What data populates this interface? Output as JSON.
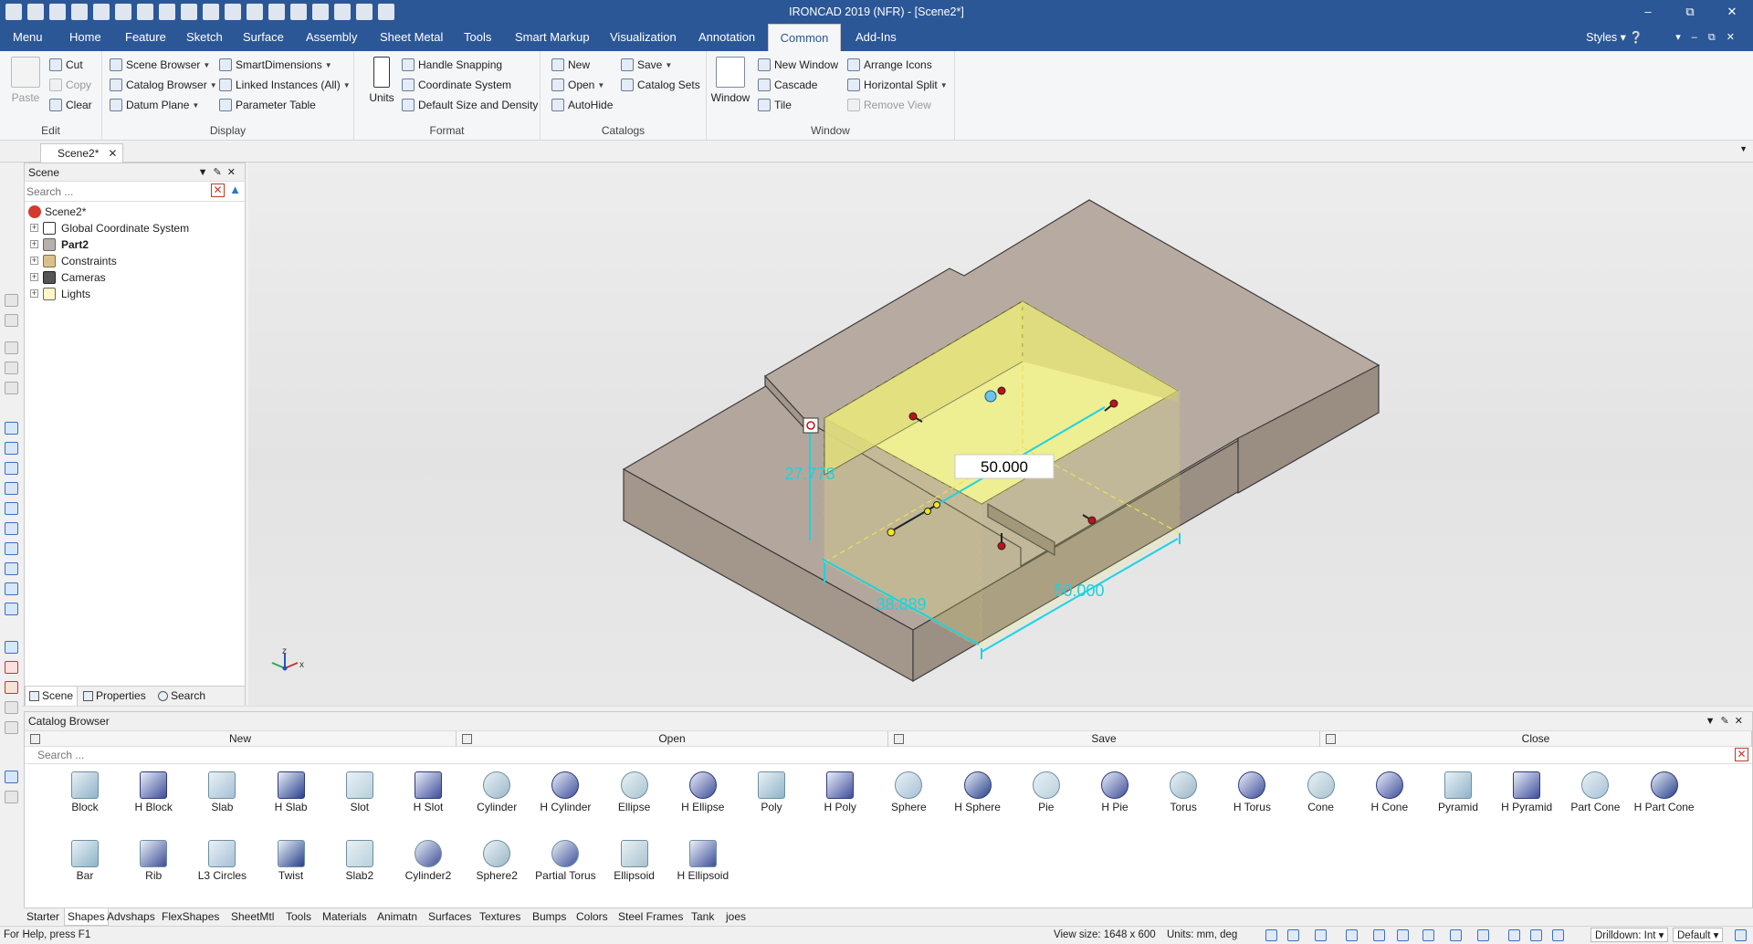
{
  "app": {
    "title": "IRONCAD 2019 (NFR) - [Scene2*]",
    "styles_label": "Styles"
  },
  "menu": {
    "tabs": [
      "Menu",
      "Home",
      "Feature",
      "Sketch",
      "Surface",
      "Assembly",
      "Sheet Metal",
      "Tools",
      "Smart Markup",
      "Visualization",
      "Annotation",
      "Common",
      "Add-Ins"
    ],
    "active": "Common"
  },
  "ribbon": {
    "edit": {
      "paste": "Paste",
      "cut": "Cut",
      "copy": "Copy",
      "clear": "Clear",
      "label": "Edit"
    },
    "display": {
      "scene_browser": "Scene Browser",
      "catalog_browser": "Catalog Browser",
      "datum_plane": "Datum Plane",
      "smart_dimensions": "SmartDimensions",
      "linked_instances": "Linked Instances (All)",
      "parameter_table": "Parameter Table",
      "label": "Display"
    },
    "format": {
      "units": "Units",
      "handle_snapping": "Handle Snapping",
      "coordinate_system": "Coordinate System",
      "default_size": "Default Size and Density",
      "label": "Format"
    },
    "catalogs": {
      "new": "New",
      "open": "Open",
      "autohide": "AutoHide",
      "save": "Save",
      "catalog_sets": "Catalog Sets",
      "label": "Catalogs"
    },
    "window": {
      "window": "Window",
      "new_window": "New Window",
      "cascade": "Cascade",
      "tile": "Tile",
      "arrange_icons": "Arrange Icons",
      "horizontal_split": "Horizontal Split",
      "remove_view": "Remove View",
      "label": "Window"
    }
  },
  "doc_tab": {
    "label": "Scene2*"
  },
  "scene_panel": {
    "title": "Scene",
    "search_placeholder": "Search ...",
    "root": "Scene2*",
    "items": [
      "Global Coordinate System",
      "Part2",
      "Constraints",
      "Cameras",
      "Lights"
    ],
    "tabs": [
      "Scene",
      "Properties",
      "Search"
    ]
  },
  "viewport": {
    "dim_edit_value": "50.000",
    "dim_height": "27.778",
    "dim_depth": "38.889",
    "dim_width": "50.000",
    "axis_z": "z",
    "axis_x": "x"
  },
  "catalog": {
    "title": "Catalog Browser",
    "buttons": [
      "New",
      "Open",
      "Save",
      "Close"
    ],
    "search_placeholder": "Search ...",
    "shapes_row1": [
      "Block",
      "H Block",
      "Slab",
      "H Slab",
      "Slot",
      "H Slot",
      "Cylinder",
      "H Cylinder",
      "Ellipse",
      "H Ellipse",
      "Poly",
      "H Poly",
      "Sphere",
      "H Sphere",
      "Pie",
      "H Pie",
      "Torus",
      "H Torus",
      "Cone",
      "H Cone",
      "Pyramid",
      "H Pyramid",
      "Part Cone",
      "H Part Cone"
    ],
    "shapes_row2": [
      "Bar",
      "Rib",
      "L3 Circles",
      "Twist",
      "Slab2",
      "Cylinder2",
      "Sphere2",
      "Partial Torus",
      "Ellipsoid",
      "H Ellipsoid"
    ],
    "tabs": [
      "Starter",
      "Shapes",
      "Advshaps",
      "FlexShapes",
      "SheetMtl",
      "Tools",
      "Materials",
      "Animatn",
      "Surfaces",
      "Textures",
      "Bumps",
      "Colors",
      "Steel Frames",
      "Tank",
      "joes"
    ],
    "active_tab": "Shapes"
  },
  "status": {
    "help": "For Help, press F1",
    "view_size": "View size: 1648 x  600",
    "units": "Units: mm, deg",
    "drilldown": "Drilldown: Int",
    "default": "Default"
  },
  "colors": {
    "title_bar": "#2b5797",
    "highlight_box": "#f2f07a",
    "model": "#b1a59b",
    "dim_cyan": "#1bd3e0"
  }
}
